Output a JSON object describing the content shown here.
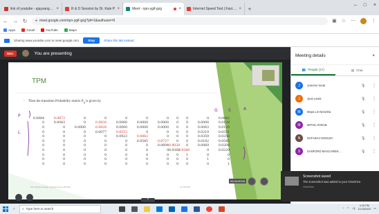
{
  "browser": {
    "tabs": [
      {
        "title": "link of youtube - ajaysangaml-",
        "color": "#c0392b",
        "active": false
      },
      {
        "title": "R & D Session by Dr. Kale P",
        "color": "#e53935",
        "active": false
      },
      {
        "title": "Meet - npn-ygif-gzg",
        "color": "#00897b",
        "active": true
      },
      {
        "title": "Internet Speed Test | Fast.com",
        "color": "#e53935",
        "active": false
      }
    ],
    "new_tab": "+",
    "win_controls": [
      "–",
      "□",
      "×"
    ],
    "url": "meet.google.com/npn-ygif-gzg?pli=1&authuser=0",
    "bookmarks": [
      {
        "label": "Apps",
        "color": "#4285f4"
      },
      {
        "label": "Gmail",
        "color": "#d93025"
      },
      {
        "label": "YouTube",
        "color": "#ff0000"
      },
      {
        "label": "Maps",
        "color": "#34a853"
      }
    ]
  },
  "share_bar": {
    "text": "Sharing www.youtube.com to meet.google.com",
    "stop_label": "Stop",
    "hide_label": "Share this tab instead"
  },
  "meet": {
    "rec_label": "REC",
    "presenting_text": "You are presenting",
    "up_label": "^"
  },
  "slide": {
    "title": "TPM",
    "text": "Then the transition Probability matrix  P",
    "text_sub": "ij",
    "text_end": " is given by",
    "annotations": [
      "G",
      "S",
      "A",
      "P",
      "L"
    ],
    "matrix": [
      [
        "0.0084",
        "0.9873",
        "0",
        "0",
        "0",
        "0",
        "0",
        "0",
        "0",
        "0",
        "0.0042"
      ],
      [
        "0",
        "0.0043",
        "0",
        "0.9830",
        "0.0000",
        "0.0000",
        "0.0000",
        "0",
        "0",
        "0.0000",
        "0.0128"
      ],
      [
        "0",
        "0",
        "0.0000",
        "0.9828",
        "0.0000",
        "0.0000",
        "0.0000",
        "0",
        "0",
        "0.0043",
        "0.0129"
      ],
      [
        "0",
        "0",
        "0",
        "0.0077",
        "0.8553",
        "0",
        "0",
        "0",
        "0",
        "0.0219",
        "0.0351"
      ],
      [
        "0",
        "0",
        "0",
        "0",
        "0.0923",
        "0.8462",
        "0",
        "0",
        "0",
        "0.0359",
        "0.0256"
      ],
      [
        "0",
        "0",
        "0",
        "0",
        "0",
        "0.0545",
        "0.8727",
        "0",
        "0",
        "0.0182",
        "0.0545"
      ],
      [
        "0",
        "0",
        "0",
        "0",
        "0",
        "0",
        "0.0694",
        "0.9028",
        "0",
        "0.0069",
        "0.0208"
      ],
      [
        "0",
        "0",
        "0",
        "0",
        "0",
        "0",
        "0",
        "0.0382",
        "0.9389",
        "0",
        "0.0229"
      ],
      [
        "0",
        "0",
        "0",
        "0",
        "0",
        "0",
        "0",
        "0",
        "1",
        "0",
        "0"
      ],
      [
        "0",
        "0",
        "0",
        "0",
        "0",
        "0",
        "0",
        "0",
        "0",
        "1",
        "0"
      ],
      [
        "0",
        "0",
        "0",
        "0",
        "0",
        "0",
        "0",
        "0",
        "0",
        "0",
        "1"
      ]
    ],
    "red_cells": [
      [
        0,
        1
      ],
      [
        1,
        3
      ],
      [
        2,
        3
      ],
      [
        3,
        4
      ],
      [
        4,
        5
      ],
      [
        5,
        6
      ],
      [
        6,
        7
      ],
      [
        7,
        8
      ]
    ],
    "footer_left": "Shri Mariya College of Engineering, Borivali",
    "footer_right": "12-10-2020",
    "control_label": "00:00:00:00"
  },
  "panel": {
    "title": "Meeting details",
    "people_tab": "People (17)",
    "chat_tab": "Chat",
    "people": [
      {
        "name": "JAIHAVI NAIK",
        "initial": "J",
        "color": "#1a73e8"
      },
      {
        "name": "Jyoti Lewis",
        "initial": "J",
        "color": "#e8710a"
      },
      {
        "name": "Maya Lin Noronha",
        "initial": "M",
        "color": "#1a73e8"
      },
      {
        "name": "MITHIL PARAB",
        "initial": "M",
        "color": "#8e24aa"
      },
      {
        "name": "NATASHA DSOUZA",
        "initial": "N",
        "color": "#6d4c41"
      },
      {
        "name": "SANFORD MASCAREN...",
        "initial": "S",
        "color": "#8e24aa"
      }
    ]
  },
  "toast": {
    "title": "Screenshot saved",
    "body": "The screenshot was added to your OneDrive.",
    "source": "OneDrive"
  },
  "taskbar": {
    "search_placeholder": "Type here to search",
    "time": "4:16 PM",
    "date": "11/18/2020"
  }
}
